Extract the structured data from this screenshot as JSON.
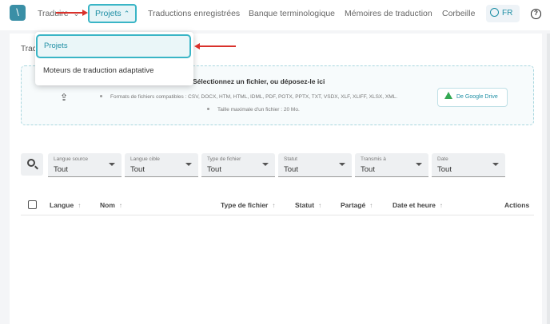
{
  "nav": {
    "logo": "\\",
    "items": [
      "Traduire",
      "Projets",
      "Traductions enregistrées",
      "Banque terminologique",
      "Mémoires de traduction",
      "Corbeille"
    ],
    "language": "FR",
    "help": "?"
  },
  "menu": {
    "items": [
      "Projets",
      "Moteurs de traduction adaptative"
    ]
  },
  "page": {
    "title": "Trac"
  },
  "upload": {
    "title": "Sélectionnez un fichier, ou déposez-le ici",
    "formats": "Formats de fichiers compatibles : CSV, DOCX, HTM, HTML, IDML, PDF, POTX, PPTX, TXT, VSDX, XLF, XLIFF, XLSX, XML.",
    "max_size": "Taille maximale d'un fichier : 20 Mo.",
    "gdrive_label": "De Google Drive"
  },
  "filters": [
    {
      "label": "Langue source",
      "value": "Tout"
    },
    {
      "label": "Langue cible",
      "value": "Tout"
    },
    {
      "label": "Type de fichier",
      "value": "Tout"
    },
    {
      "label": "Statut",
      "value": "Tout"
    },
    {
      "label": "Transmis à",
      "value": "Tout"
    },
    {
      "label": "Date",
      "value": "Tout"
    }
  ],
  "table": {
    "columns": [
      "Langue",
      "Nom",
      "Type de fichier",
      "Statut",
      "Partagé",
      "Date et heure",
      "Actions"
    ],
    "sort_glyph": "↑"
  },
  "colors": {
    "accent": "#3ab5c6",
    "annotation": "#d9312b"
  }
}
